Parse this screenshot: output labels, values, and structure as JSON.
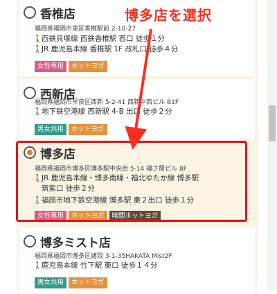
{
  "stores": [
    {
      "name": "香椎店",
      "address": "福岡県福岡市東区香椎駅前 2-10-27",
      "routes": [
        "西鉄貝塚線 西鉄香椎駅 西口 徒歩１分",
        "JR 鹿児島本線 香椎駅 1F 改札口 徒歩４分"
      ],
      "tags": [
        "女性専用",
        "ホットヨガ"
      ]
    },
    {
      "name": "西新店",
      "address": "福岡県福岡市早良区西新 5-2-41 西新中西ビル B1F",
      "routes": [
        "地下鉄空港線 西新駅 4-B 出口 徒歩２分"
      ],
      "tags": [
        "男女共用",
        "ホットヨガ"
      ]
    },
    {
      "name": "博多店",
      "address": "福岡県福岡市博多区博多駅中央街 5-14 福さ屋ビル 8F",
      "routes": [
        "JR 鹿児島本線・博多南線・福北ゆたか線 博多駅",
        "筑紫口 徒歩２分",
        "福岡市地下鉄空港線 博多駅 東２出口 徒歩１分"
      ],
      "tags": [
        "女性専用",
        "ホットヨガ",
        "暗闇ホットヨガ"
      ]
    },
    {
      "name": "博多ミスト店",
      "address": "福岡県福岡市博多区諸岡 3-1-35HAKATA Mist2F",
      "routes": [
        "鹿児島本線 竹下駅 東口 徒歩１４分"
      ],
      "tags": [
        "男女共用",
        "ホットヨガ"
      ]
    }
  ],
  "selected_store": "博多店",
  "annotation": {
    "label": "博多店を選択",
    "color": "#ff2d1f"
  },
  "colors": {
    "accent_orange": "#e8913a",
    "women_pink": "#dc5c84",
    "unisex_green": "#2f9e86",
    "dark_yoga": "#5a4a3a",
    "highlight_red": "#e8101a"
  },
  "icons": {
    "walk": "walking-person-icon"
  }
}
